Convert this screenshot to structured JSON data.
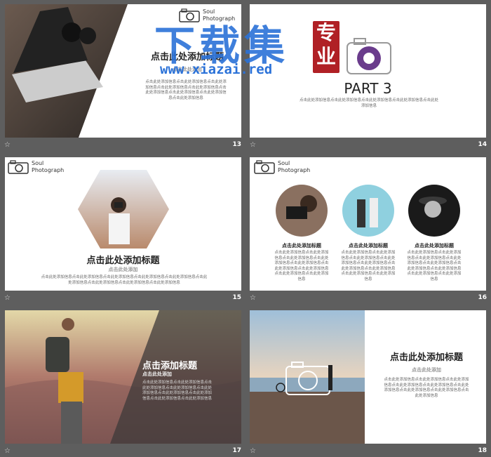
{
  "watermark": {
    "title": "下载集",
    "url": "www.xiazai.red",
    "seal": "专业"
  },
  "logo_text_line1": "Soul",
  "logo_text_line2": "Photograph",
  "placeholder_body": "点击此处添加信息点击此处添加信息点击此处添加信息点击此处添加信息点击此处添加信息点击此处添加信息点击此处添加信息点击此处添加信息点击此处添加信息",
  "slides": [
    {
      "num": "13",
      "title": "点击此处添加标题",
      "sub": "点击此处添加"
    },
    {
      "num": "14",
      "title": "PART 3",
      "sub": "点击此处添加信息点击此处添加信息点击此处添加信息点击此处添加信息点击此处添加信息"
    },
    {
      "num": "15",
      "title": "点击此处添加标题",
      "sub": "点击此处添加"
    },
    {
      "num": "16",
      "caption": "点击此处添加标题"
    },
    {
      "num": "17",
      "title": "点击添加标题",
      "sub": "点击此处添加"
    },
    {
      "num": "18",
      "title": "点击此处添加标题",
      "sub": "点击此处添加"
    }
  ],
  "colors": {
    "background": "#5e5e5e",
    "bar": "#4f4f4f",
    "watermark": "#2b72d8",
    "seal": "#b02025"
  }
}
